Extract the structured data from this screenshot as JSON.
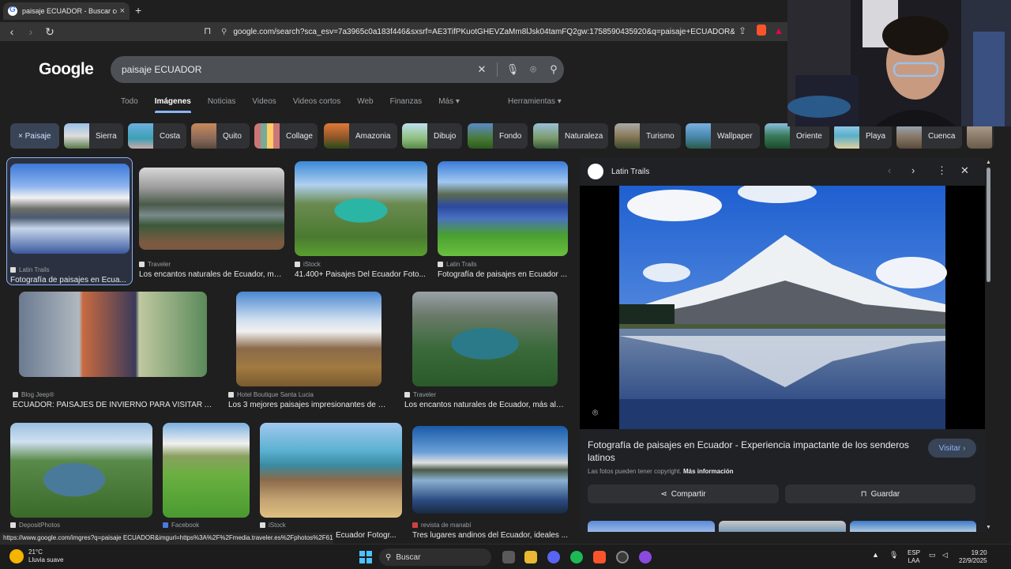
{
  "browser": {
    "tab_title": "paisaje ECUADOR - Buscar con Google",
    "new_tab": "+",
    "url": "google.com/search?sca_esv=7a3965c0a183f446&sxsrf=AE3TifPKuotGHEVZaMm8lJsk04tamFQ2gw:1758590435920&q=paisaje+ECUADOR&uds=AO...",
    "back": "‹",
    "forward": "›",
    "reload": "↻",
    "close": "×"
  },
  "google": {
    "logo": "Google",
    "query": "paisaje ECUADOR",
    "tabs": [
      "Todo",
      "Imágenes",
      "Noticias",
      "Videos",
      "Videos cortos",
      "Web",
      "Finanzas",
      "Más ▾"
    ],
    "active_tab": "Imágenes",
    "tools": "Herramientas ▾"
  },
  "chips": [
    {
      "label": "× Paisaje",
      "selected": true
    },
    {
      "label": "Sierra"
    },
    {
      "label": "Costa"
    },
    {
      "label": "Quito"
    },
    {
      "label": "Collage"
    },
    {
      "label": "Amazonia"
    },
    {
      "label": "Dibujo"
    },
    {
      "label": "Fondo"
    },
    {
      "label": "Naturaleza"
    },
    {
      "label": "Turismo"
    },
    {
      "label": "Wallpaper"
    },
    {
      "label": "Oriente"
    },
    {
      "label": "Playa"
    },
    {
      "label": "Cuenca"
    }
  ],
  "results": [
    {
      "source": "Latin Trails",
      "caption": "Fotografía de paisajes en Ecua..."
    },
    {
      "source": "Traveler",
      "caption": "Los encantos naturales de Ecuador, má..."
    },
    {
      "source": "iStock",
      "caption": "41.400+ Paisajes Del Ecuador Foto..."
    },
    {
      "source": "Latin Trails",
      "caption": "Fotografía de paisajes en Ecuador ..."
    },
    {
      "source": "Blog Jeep®",
      "caption": "ECUADOR: PAISAJES DE INVIERNO PARA VISITAR A ..."
    },
    {
      "source": "Hotel Boutique Santa Lucia",
      "caption": "Los 3 mejores paisajes impresionantes de Ec..."
    },
    {
      "source": "Traveler",
      "caption": "Los encantos naturales de Ecuador, más allá ..."
    },
    {
      "source": "DepositPhotos",
      "caption": ""
    },
    {
      "source": "Facebook",
      "caption": ""
    },
    {
      "source": "iStock",
      "caption": "Ecuador Fotogr..."
    },
    {
      "source": "revista de manabí",
      "caption": "Tres lugares andinos del Ecuador, ideales ..."
    }
  ],
  "preview": {
    "source": "Latin Trails",
    "title": "Fotografía de paisajes en Ecuador - Experiencia impactante de los senderos latinos",
    "visit": "Visitar ›",
    "copyright": "Las fotos pueden tener copyright.",
    "more_info": "Más información",
    "share": "Compartir",
    "save": "Guardar"
  },
  "status_url": "https://www.google.com/imgres?q=paisaje ECUADOR&imgurl=https%3A%2F%2Fmedia.traveler.es%2Fphotos%2F61...",
  "taskbar": {
    "temp": "21°C",
    "weather": "Lluvia suave",
    "search": "Buscar",
    "lang1": "ESP",
    "lang2": "LAA",
    "time": "19:20",
    "date": "22/9/2025"
  },
  "colors": {
    "accent": "#8ab4f8",
    "background": "#1f1f1f",
    "panel": "#202124"
  }
}
